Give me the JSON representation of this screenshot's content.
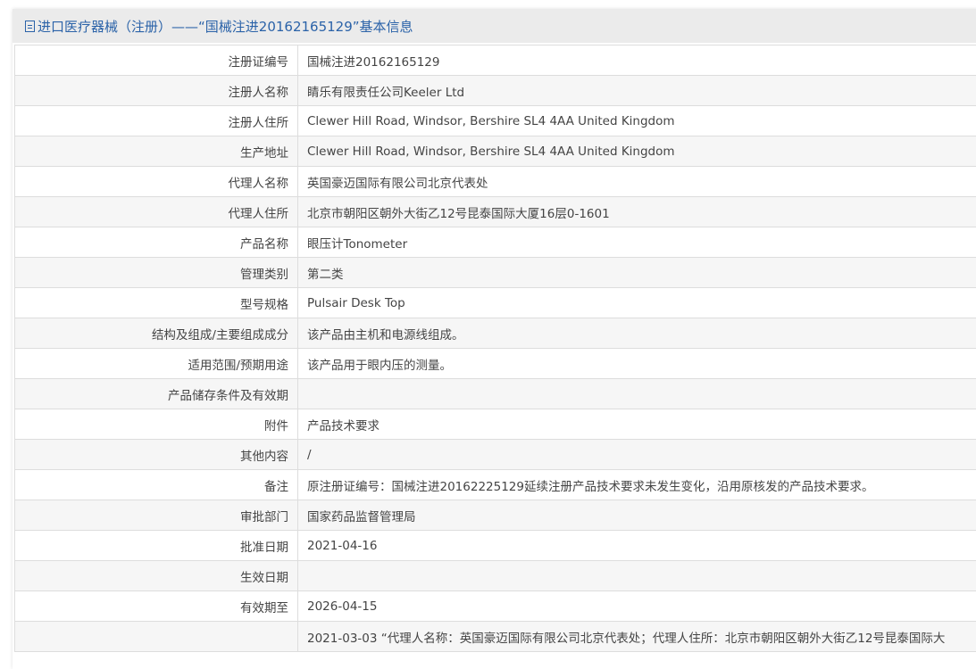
{
  "header": {
    "title": "进口医疗器械（注册）——“国械注进20162165129”基本信息"
  },
  "rows": [
    {
      "label": "注册证编号",
      "value": "国械注进20162165129"
    },
    {
      "label": "注册人名称",
      "value": "睛乐有限责任公司Keeler Ltd"
    },
    {
      "label": "注册人住所",
      "value": "Clewer Hill Road, Windsor, Bershire SL4 4AA United Kingdom"
    },
    {
      "label": "生产地址",
      "value": "Clewer Hill Road, Windsor, Bershire SL4 4AA United Kingdom"
    },
    {
      "label": "代理人名称",
      "value": "英国豪迈国际有限公司北京代表处"
    },
    {
      "label": "代理人住所",
      "value": "北京市朝阳区朝外大街乙12号昆泰国际大厦16层0-1601"
    },
    {
      "label": "产品名称",
      "value": "眼压计Tonometer"
    },
    {
      "label": "管理类别",
      "value": "第二类"
    },
    {
      "label": "型号规格",
      "value": "Pulsair Desk Top"
    },
    {
      "label": "结构及组成/主要组成成分",
      "value": "该产品由主机和电源线组成。"
    },
    {
      "label": "适用范围/预期用途",
      "value": "该产品用于眼内压的测量。"
    },
    {
      "label": "产品储存条件及有效期",
      "value": ""
    },
    {
      "label": "附件",
      "value": "产品技术要求"
    },
    {
      "label": "其他内容",
      "value": "/"
    },
    {
      "label": "备注",
      "value": "原注册证编号：国械注进20162225129延续注册产品技术要求未发生变化，沿用原核发的产品技术要求。"
    },
    {
      "label": "审批部门",
      "value": "国家药品监督管理局"
    },
    {
      "label": "批准日期",
      "value": "2021-04-16"
    },
    {
      "label": "生效日期",
      "value": ""
    },
    {
      "label": "有效期至",
      "value": "2026-04-15"
    },
    {
      "label": "",
      "value": "2021-03-03 “代理人名称：英国豪迈国际有限公司北京代表处；代理人住所：北京市朝阳区朝外大街乙12号昆泰国际大"
    }
  ]
}
